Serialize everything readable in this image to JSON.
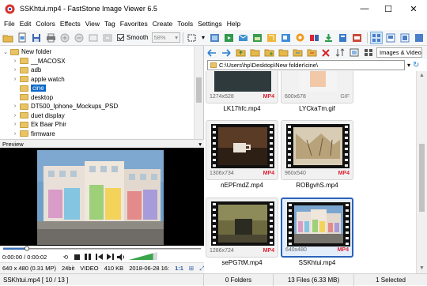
{
  "window": {
    "title": "SSKhtui.mp4 - FastStone Image Viewer 6.5",
    "minimize": "—",
    "maximize": "☐",
    "close": "✕"
  },
  "menu": [
    "File",
    "Edit",
    "Colors",
    "Effects",
    "View",
    "Tag",
    "Favorites",
    "Create",
    "Tools",
    "Settings",
    "Help"
  ],
  "toolbar": {
    "smooth_label": "Smooth",
    "smooth_checked": true,
    "zoom_value": "58%"
  },
  "tree": {
    "items": [
      {
        "label": "New folder",
        "indent": 0,
        "expander": "⌄"
      },
      {
        "label": "__MACOSX",
        "indent": 1,
        "expander": "›"
      },
      {
        "label": "adb",
        "indent": 1,
        "expander": "›"
      },
      {
        "label": "apple watch",
        "indent": 1,
        "expander": "›"
      },
      {
        "label": "cine",
        "indent": 1,
        "expander": "",
        "selected": true
      },
      {
        "label": "desktop",
        "indent": 1,
        "expander": ""
      },
      {
        "label": "DT500_Iphone_Mockups_PSD",
        "indent": 1,
        "expander": "›"
      },
      {
        "label": "duet display",
        "indent": 1,
        "expander": "›"
      },
      {
        "label": "Ek Baar Phir",
        "indent": 1,
        "expander": "›"
      },
      {
        "label": "firmware",
        "indent": 1,
        "expander": "›"
      }
    ]
  },
  "preview": {
    "label": "Preview",
    "time": "0:00:00 / 0:00:02",
    "progress": 0.12,
    "volume": 0.85
  },
  "infobar": {
    "dimensions": "640 x 480 (0.31 MP)",
    "bit_depth": "24bit",
    "kind": "VIDEO",
    "size": "410 KB",
    "date": "2018-06-28 16:",
    "zoom": "1:1"
  },
  "right": {
    "filter": "Images & Video",
    "path": "C:\\Users\\hp\\Desktop\\New folder\\cine\\"
  },
  "thumbnails": [
    {
      "name": "LK17hfc.mp4",
      "dims": "1274x528",
      "fmt": "MP4"
    },
    {
      "name": "LYCkaTm.gif",
      "dims": "600x678",
      "fmt": "GIF"
    },
    {
      "name": "nEPFmdZ.mp4",
      "dims": "1306x734",
      "fmt": "MP4"
    },
    {
      "name": "ROBgvhS.mp4",
      "dims": "960x540",
      "fmt": "MP4"
    },
    {
      "name": "sePG7tM.mp4",
      "dims": "1286x724",
      "fmt": "MP4"
    },
    {
      "name": "SSKhtui.mp4",
      "dims": "640x480",
      "fmt": "MP4",
      "selected": true
    }
  ],
  "status": {
    "file": "SSKhtui.mp4 [ 10 / 13 ]",
    "folders": "0 Folders",
    "files": "13 Files (6.33 MB)",
    "selected": "1 Selected"
  }
}
